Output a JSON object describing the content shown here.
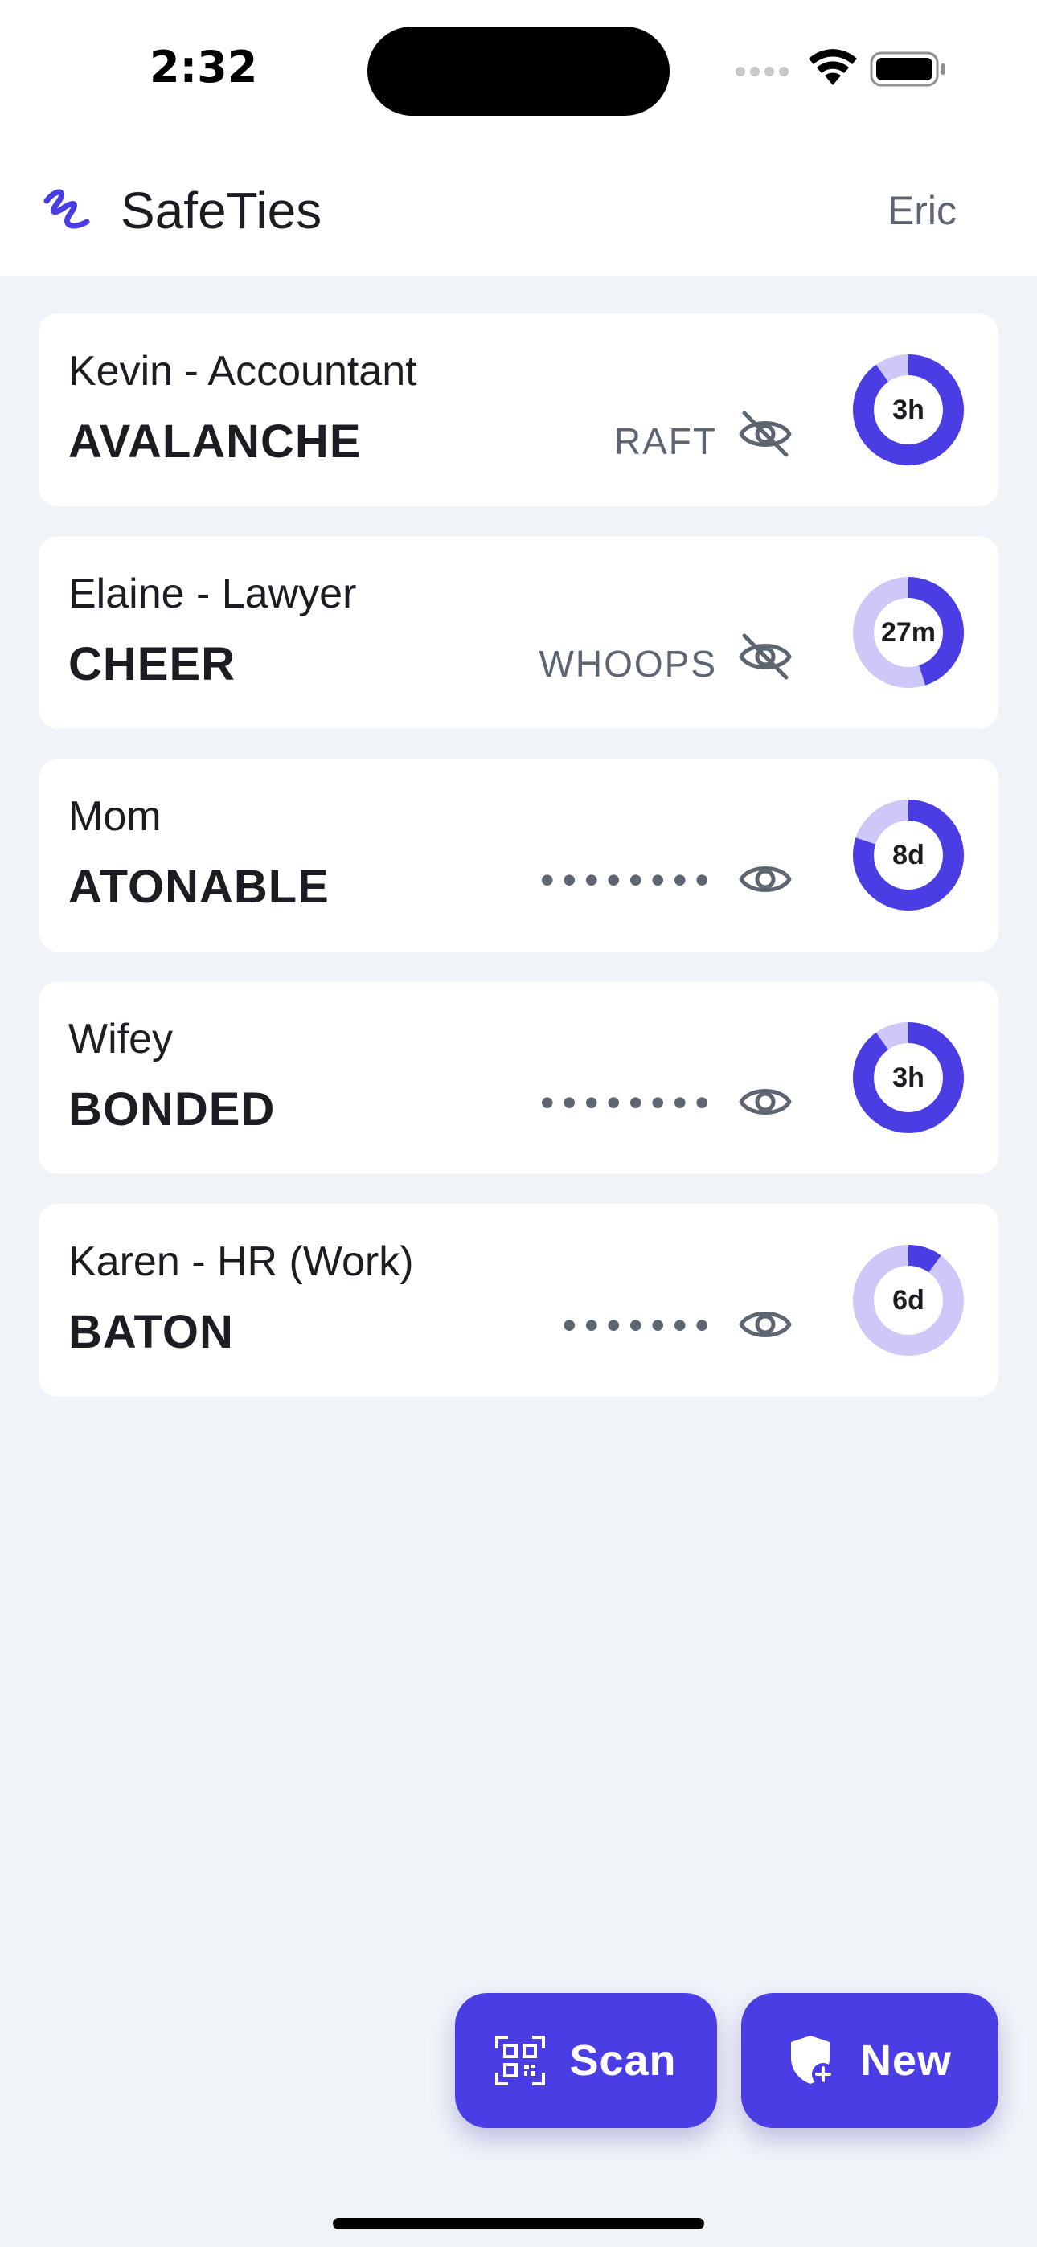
{
  "status_bar": {
    "time": "2:32"
  },
  "header": {
    "title": "SafeTies",
    "user": "Eric"
  },
  "colors": {
    "accent": "#4a3de4",
    "accent_light": "#cdc8f7"
  },
  "cards": [
    {
      "name": "Kevin - Accountant",
      "word": "AVALANCHE",
      "response": "RAFT",
      "revealed": true,
      "timer": "3h",
      "timer_progress": 0.9
    },
    {
      "name": "Elaine - Lawyer",
      "word": "CHEER",
      "response": "WHOOPS",
      "revealed": true,
      "timer": "27m",
      "timer_progress": 0.45
    },
    {
      "name": "Mom",
      "word": "ATONABLE",
      "response": "••••••••",
      "revealed": false,
      "timer": "8d",
      "timer_progress": 0.8
    },
    {
      "name": "Wifey",
      "word": "BONDED",
      "response": "••••••••",
      "revealed": false,
      "timer": "3h",
      "timer_progress": 0.9
    },
    {
      "name": "Karen - HR (Work)",
      "word": "BATON",
      "response": "•••••••",
      "revealed": false,
      "timer": "6d",
      "timer_progress": 0.1
    }
  ],
  "buttons": {
    "scan_label": "Scan",
    "new_label": "New"
  }
}
